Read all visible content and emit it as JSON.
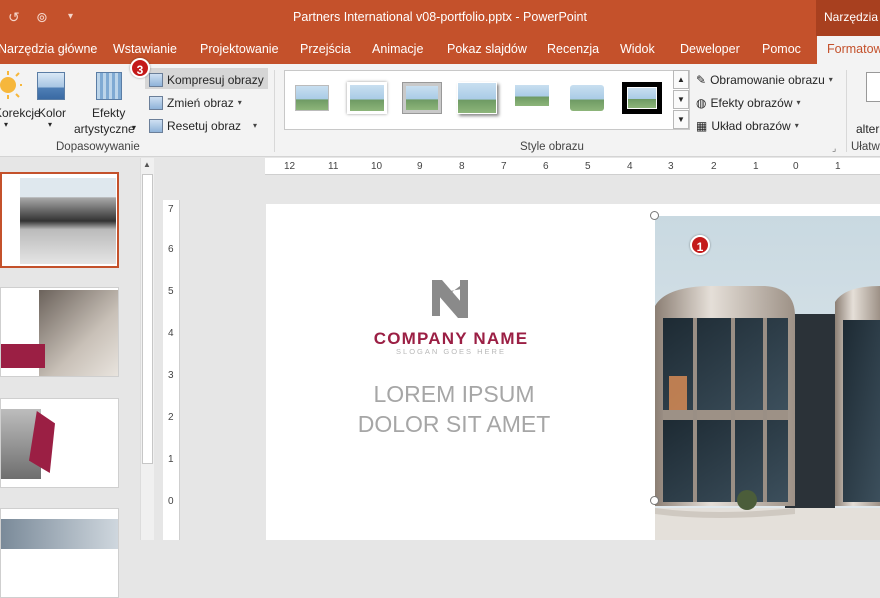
{
  "titlebar": {
    "document_title": "Partners International v08-portfolio.pptx  -  PowerPoint",
    "contextual_tab": "Narzędzia obrazów"
  },
  "tabs": [
    {
      "label": "Narzędzia główne"
    },
    {
      "label": "Wstawianie"
    },
    {
      "label": "Projektowanie"
    },
    {
      "label": "Przejścia"
    },
    {
      "label": "Animacje"
    },
    {
      "label": "Pokaz slajdów"
    },
    {
      "label": "Recenzja"
    },
    {
      "label": "Widok"
    },
    {
      "label": "Deweloper"
    },
    {
      "label": "Pomoc"
    },
    {
      "label": "Formatowanie"
    }
  ],
  "ribbon": {
    "adjust": {
      "corrections_label": "Korekcje",
      "color_label": "Kolor",
      "artistic_line1": "Efekty",
      "artistic_line2": "artystyczne",
      "compress_label": "Kompresuj obrazy",
      "change_label": "Zmień obraz",
      "reset_label": "Resetuj obraz",
      "group_label": "Dopasowywanie"
    },
    "styles": {
      "group_label": "Style obrazu",
      "border_label": "Obramowanie obrazu",
      "effects_label": "Efekty obrazów",
      "layout_label": "Układ obrazów"
    },
    "accessibility": {
      "alt_label": "alter",
      "group_label": "Ułatw"
    }
  },
  "badges": {
    "compress_step": "3",
    "photo_step": "1"
  },
  "rulers": {
    "horizontal": [
      "12",
      "11",
      "10",
      "9",
      "8",
      "7",
      "6",
      "5",
      "4",
      "3",
      "2",
      "1",
      "0",
      "1"
    ],
    "vertical": [
      "7",
      "6",
      "5",
      "4",
      "3",
      "2",
      "1",
      "0"
    ]
  },
  "slide": {
    "company_name": "COMPANY NAME",
    "slogan": "SLOGAN GOES HERE",
    "headline_line1": "LOREM IPSUM",
    "headline_line2": "DOLOR SIT AMET"
  },
  "colors": {
    "accent": "#c4512b",
    "brand": "#9b1f44",
    "badge": "#c41a1a"
  }
}
